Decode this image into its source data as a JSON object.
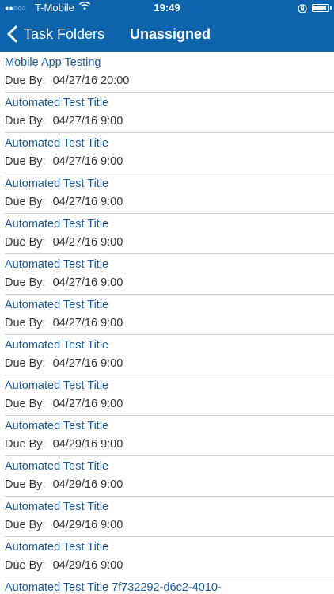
{
  "status_bar": {
    "signal": "●●○○○",
    "carrier": "T-Mobile",
    "time": "19:49",
    "battery_level": 0.9
  },
  "nav": {
    "back_label": "Task Folders",
    "title": "Unassigned"
  },
  "colors": {
    "header_bg": "#0e64ac",
    "title_text": "#1a5a9c",
    "due_text": "#333333"
  },
  "tasks": [
    {
      "title": "Mobile App Testing",
      "due_label": "Due By:",
      "due": "04/27/16 20:00"
    },
    {
      "title": "Automated Test Title",
      "due_label": "Due By:",
      "due": "04/27/16 9:00"
    },
    {
      "title": "Automated Test Title",
      "due_label": "Due By:",
      "due": "04/27/16 9:00"
    },
    {
      "title": "Automated Test Title",
      "due_label": "Due By:",
      "due": "04/27/16 9:00"
    },
    {
      "title": "Automated Test Title",
      "due_label": "Due By:",
      "due": "04/27/16 9:00"
    },
    {
      "title": "Automated Test Title",
      "due_label": "Due By:",
      "due": "04/27/16 9:00"
    },
    {
      "title": "Automated Test Title",
      "due_label": "Due By:",
      "due": "04/27/16 9:00"
    },
    {
      "title": "Automated Test Title",
      "due_label": "Due By:",
      "due": "04/27/16 9:00"
    },
    {
      "title": "Automated Test Title",
      "due_label": "Due By:",
      "due": "04/27/16 9:00"
    },
    {
      "title": "Automated Test Title",
      "due_label": "Due By:",
      "due": "04/29/16 9:00"
    },
    {
      "title": "Automated Test Title",
      "due_label": "Due By:",
      "due": "04/29/16 9:00"
    },
    {
      "title": "Automated Test Title",
      "due_label": "Due By:",
      "due": "04/29/16 9:00"
    },
    {
      "title": "Automated Test Title",
      "due_label": "Due By:",
      "due": "04/29/16 9:00"
    },
    {
      "title": "Automated Test Title 7f732292-d6c2-4010-",
      "due_label": "",
      "due": ""
    }
  ]
}
